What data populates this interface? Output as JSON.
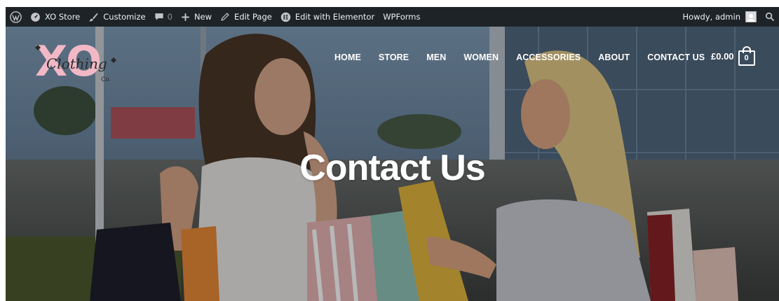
{
  "admin_bar": {
    "site_name": "XO Store",
    "customize": "Customize",
    "comments_count": "0",
    "new": "New",
    "edit_page": "Edit Page",
    "elementor": "Edit with Elementor",
    "wpforms": "WPForms",
    "howdy": "Howdy, admin"
  },
  "header": {
    "logo_text": "XO",
    "logo_script": "Clothing",
    "logo_suffix": "Co.",
    "nav": [
      "HOME",
      "STORE",
      "MEN",
      "WOMEN",
      "ACCESSORIES",
      "ABOUT",
      "CONTACT US"
    ],
    "cart_total": "£0.00",
    "cart_count": "0"
  },
  "hero": {
    "title": "Contact Us"
  },
  "colors": {
    "admin_bar_bg": "#1d2327",
    "logo_pink": "#f2b8c6",
    "nav_text": "#ffffff"
  }
}
